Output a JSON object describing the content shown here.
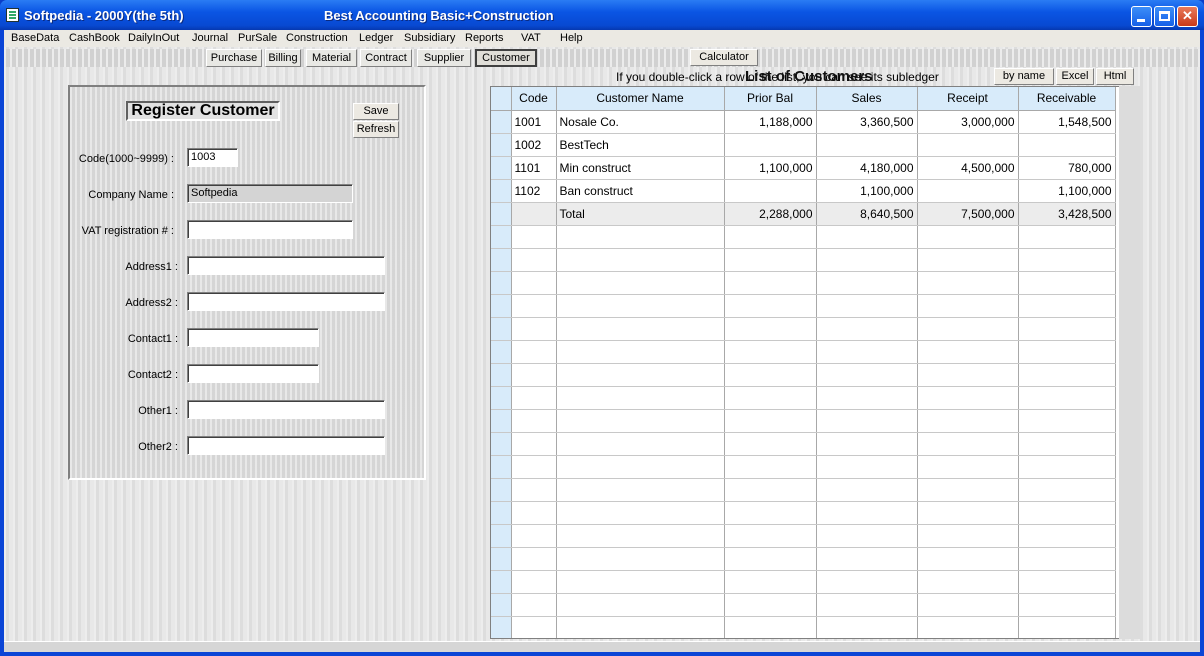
{
  "window": {
    "title": "Softpedia - 2000Y(the 5th)",
    "app_name": "Best Accounting Basic+Construction",
    "minimize_glyph": "_",
    "maximize_glyph": "□",
    "close_glyph": "✕"
  },
  "menu": [
    {
      "label": "BaseData",
      "name": "menu-basedata"
    },
    {
      "label": "CashBook",
      "name": "menu-cashbook"
    },
    {
      "label": "DailyInOut",
      "name": "menu-dailyinout"
    },
    {
      "label": "Journal",
      "name": "menu-journal"
    },
    {
      "label": "PurSale",
      "name": "menu-pursale"
    },
    {
      "label": "Construction",
      "name": "menu-construction"
    },
    {
      "label": "Ledger",
      "name": "menu-ledger"
    },
    {
      "label": "Subsidiary",
      "name": "menu-subsidiary"
    },
    {
      "label": "Reports",
      "name": "menu-reports"
    },
    {
      "label": "VAT",
      "name": "menu-vat"
    },
    {
      "label": "Help",
      "name": "menu-help"
    }
  ],
  "tabs": [
    {
      "label": "Purchase",
      "active": false
    },
    {
      "label": "Billing",
      "active": false
    },
    {
      "label": "Material",
      "active": false
    },
    {
      "label": "Contract",
      "active": false
    },
    {
      "label": "Supplier",
      "active": false
    },
    {
      "label": "Customer",
      "active": true
    }
  ],
  "toolbar": {
    "calculator_label": "Calculator",
    "by_name_label": "by name",
    "excel_label": "Excel",
    "html_label": "Html"
  },
  "info_text": "If you double-click a row of the list, you can see its subledger",
  "list_title": "List of Customers",
  "register": {
    "title": "Register Customer",
    "save_label": "Save",
    "refresh_label": "Refresh",
    "fields": [
      {
        "label": "Code(1000~9999) :",
        "value": "1003"
      },
      {
        "label": "Company Name  :",
        "value": "Softpedia"
      },
      {
        "label": "VAT registration # :",
        "value": ""
      },
      {
        "label": "Address1 :",
        "value": ""
      },
      {
        "label": "Address2 :",
        "value": ""
      },
      {
        "label": "Contact1 :",
        "value": ""
      },
      {
        "label": "Contact2 :",
        "value": ""
      },
      {
        "label": "Other1 :",
        "value": ""
      },
      {
        "label": "Other2 :",
        "value": ""
      }
    ]
  },
  "grid": {
    "columns": [
      "Code",
      "Customer Name",
      "Prior Bal",
      "Sales",
      "Receipt",
      "Receivable"
    ],
    "rows": [
      [
        "1001",
        "Nosale Co.",
        "1,188,000",
        "3,360,500",
        "3,000,000",
        "1,548,500"
      ],
      [
        "1002",
        "BestTech",
        "",
        "",
        "",
        ""
      ],
      [
        "1101",
        "Min construct",
        "1,100,000",
        "4,180,000",
        "4,500,000",
        "780,000"
      ],
      [
        "1102",
        "Ban construct",
        "",
        "1,100,000",
        "",
        "1,100,000"
      ]
    ],
    "total": [
      "",
      "Total",
      "2,288,000",
      "8,640,500",
      "7,500,000",
      "3,428,500"
    ],
    "empty_rows": 18
  }
}
